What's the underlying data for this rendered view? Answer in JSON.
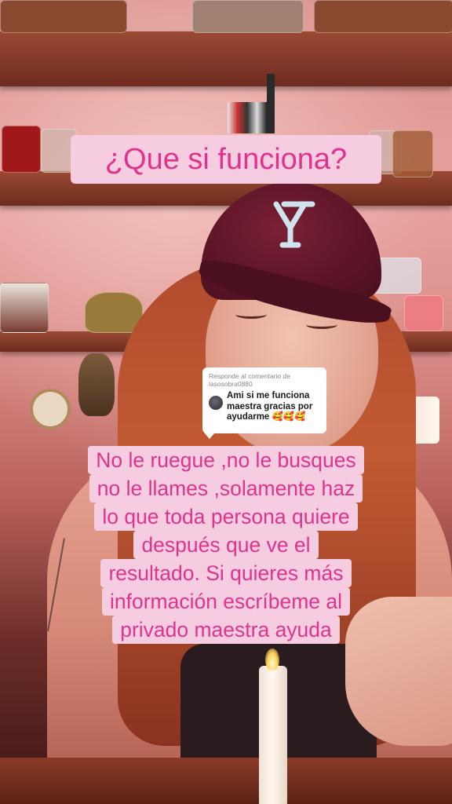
{
  "overlay": {
    "title": "¿Que si funciona?",
    "comment": {
      "reply_label": "Responde al comentario de",
      "username": "lasosobra0880",
      "text": "Ami si me funciona maestra gracias por ayudarme 🥰🥰🥰"
    },
    "caption_lines": [
      "No le ruegue ,no le busques",
      "no le llames ,solamente haz",
      "lo que toda persona quiere",
      "después que ve el",
      "resultado. Si quieres más",
      "información escríbeme al",
      "privado maestra ayuda"
    ]
  },
  "colors": {
    "overlay_bg": "#f6cde0",
    "overlay_text": "#e0338f",
    "cap": "#5c1427"
  }
}
